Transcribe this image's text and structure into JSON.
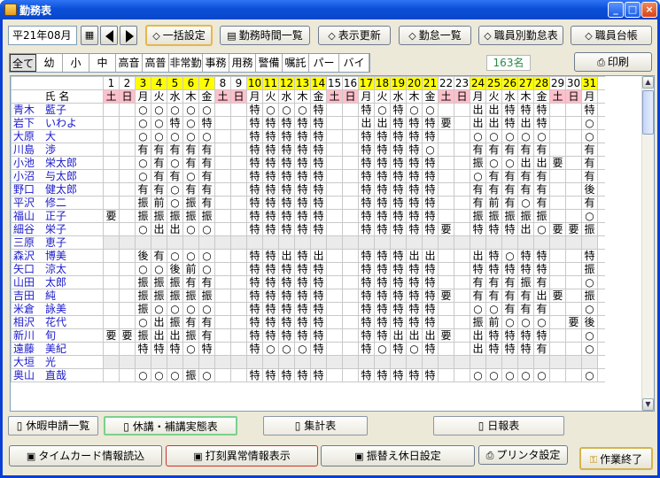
{
  "window": {
    "title": "勤務表"
  },
  "toolbar": {
    "date": "平21年08月",
    "btn_bulk": "一括設定",
    "btn_hours": "勤務時間一覧",
    "btn_refresh": "表示更新",
    "btn_attend": "勤怠一覧",
    "btn_staff_attend": "職員別勤怠表",
    "btn_staff_ledger": "職員台帳"
  },
  "filters": [
    "全て",
    "幼",
    "小",
    "中",
    "高音",
    "高普",
    "非常勤",
    "事務",
    "用務",
    "警備",
    "嘱託",
    "パート",
    "バイト"
  ],
  "filter_selected": "全て",
  "count": "163名",
  "print_label": "印刷",
  "name_header": "氏 名",
  "days": [
    "1",
    "2",
    "3",
    "4",
    "5",
    "6",
    "7",
    "8",
    "9",
    "10",
    "11",
    "12",
    "13",
    "14",
    "15",
    "16",
    "17",
    "18",
    "19",
    "20",
    "21",
    "22",
    "23",
    "24",
    "25",
    "26",
    "27",
    "28",
    "29",
    "30",
    "31"
  ],
  "weekdays": [
    "土",
    "日",
    "月",
    "火",
    "水",
    "木",
    "金",
    "土",
    "日",
    "月",
    "火",
    "水",
    "木",
    "金",
    "土",
    "日",
    "月",
    "火",
    "水",
    "木",
    "金",
    "土",
    "日",
    "月",
    "火",
    "水",
    "木",
    "金",
    "土",
    "日",
    "月"
  ],
  "rows": [
    {
      "name": "青木　藍子",
      "marks": "  ○○○○○  特○○○特  特○特○○  出出特特特  特"
    },
    {
      "name": "岩下　いわよ",
      "marks": "  ○○特○特  特特特特特  出出特特特要 出出特出特  ○"
    },
    {
      "name": "大原　大",
      "marks": "  ○○○○○  特特特特特  特特特特特  ○○○○○  ○"
    },
    {
      "name": "川島　渉",
      "marks": "  有有有有有  特特特特特  特特特特○  有有有有有  有"
    },
    {
      "name": "小池　栄太郎",
      "marks": "  ○有○有有  特特特特特  特特特特特  振○○出出要 有"
    },
    {
      "name": "小沼　与太郎",
      "marks": "  ○有有○有  特特特特特  特特特特特  ○有有有有  有"
    },
    {
      "name": "野口　健太郎",
      "marks": "  有有○有有  特特特特特  特特特特特  有有有有有  後"
    },
    {
      "name": "平沢　修二",
      "marks": "  振前○振有  特特特特特  特特特特特  有前有○有  有"
    },
    {
      "name": "福山　正子",
      "marks": "要 振振振振振  特特特特特  特特特特特  振振振振振  ○"
    },
    {
      "name": "細谷　栄子",
      "marks": "  ○出出○○  特特特特特  特特特特特要 特特特出○要要振"
    },
    {
      "name": "三原　恵子",
      "marks": "                               "
    },
    {
      "name": "森沢　博美",
      "marks": "  後有○○○  特特出特出  特特特出出  出特○特特  特"
    },
    {
      "name": "矢口　涼太",
      "marks": "  ○○後前○  特特特特特  特特特特特  特特特特特  振"
    },
    {
      "name": "山田　太郎",
      "marks": "  振振振有有  特特特特特  特特特特特  有有有振有  ○"
    },
    {
      "name": "吉田　純",
      "marks": "  振振振振振  特特特特特  特特特特特要 有有有有出要 振"
    },
    {
      "name": "米倉　詠美",
      "marks": "  振○○○○  特特特特特  特特特特特  ○○有有有  ○"
    },
    {
      "name": "相沢　花代",
      "marks": "  ○出振有有  特特特特特  特特特特特  振前○○○ 要後"
    },
    {
      "name": "新川　旬",
      "marks": "要要振出出振有  特特特特特  特特出出出要 出特特特特  ○"
    },
    {
      "name": "遠藤　美紀",
      "marks": "  特特特○特  特○○○特  特○特○特  出特特特有  ○"
    },
    {
      "name": "大垣　光",
      "marks": "                               "
    },
    {
      "name": "奥山　直哉",
      "marks": "  ○○○振○  特特特特特  特特特特特  ○○○○○  ○"
    }
  ],
  "tabs": [
    "休暇申請一覧",
    "休講・補講実態表",
    "集計表",
    "日報表"
  ],
  "tab_active": "休講・補講実態表",
  "bottom": {
    "timecard": "タイムカード情報読込",
    "anomaly": "打刻異常情報表示",
    "substitute": "振替え休日設定",
    "printer": "プリンタ設定",
    "finish": "作業終了"
  }
}
